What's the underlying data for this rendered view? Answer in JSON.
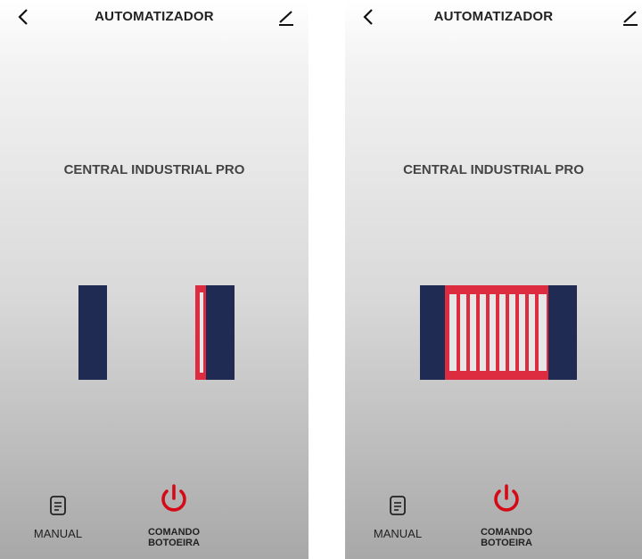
{
  "screens": [
    {
      "header": {
        "title": "AUTOMATIZADOR"
      },
      "device_name": "CENTRAL INDUSTRIAL PRO",
      "gate_state": "open",
      "bottom": {
        "manual_label": "MANUAL",
        "command_label_line1": "COMANDO",
        "command_label_line2": "BOTOEIRA"
      }
    },
    {
      "header": {
        "title": "AUTOMATIZADOR"
      },
      "device_name": "CENTRAL INDUSTRIAL PRO",
      "gate_state": "closed",
      "bottom": {
        "manual_label": "MANUAL",
        "command_label_line1": "COMANDO",
        "command_label_line2": "BOTOEIRA"
      }
    }
  ],
  "icons": {
    "back": "chevron-left-icon",
    "edit": "pencil-icon",
    "manual": "document-icon",
    "command": "power-icon"
  },
  "colors": {
    "post": "#1f2b52",
    "gate": "#dd2b40",
    "power": "#d40a16",
    "text": "#222222"
  }
}
